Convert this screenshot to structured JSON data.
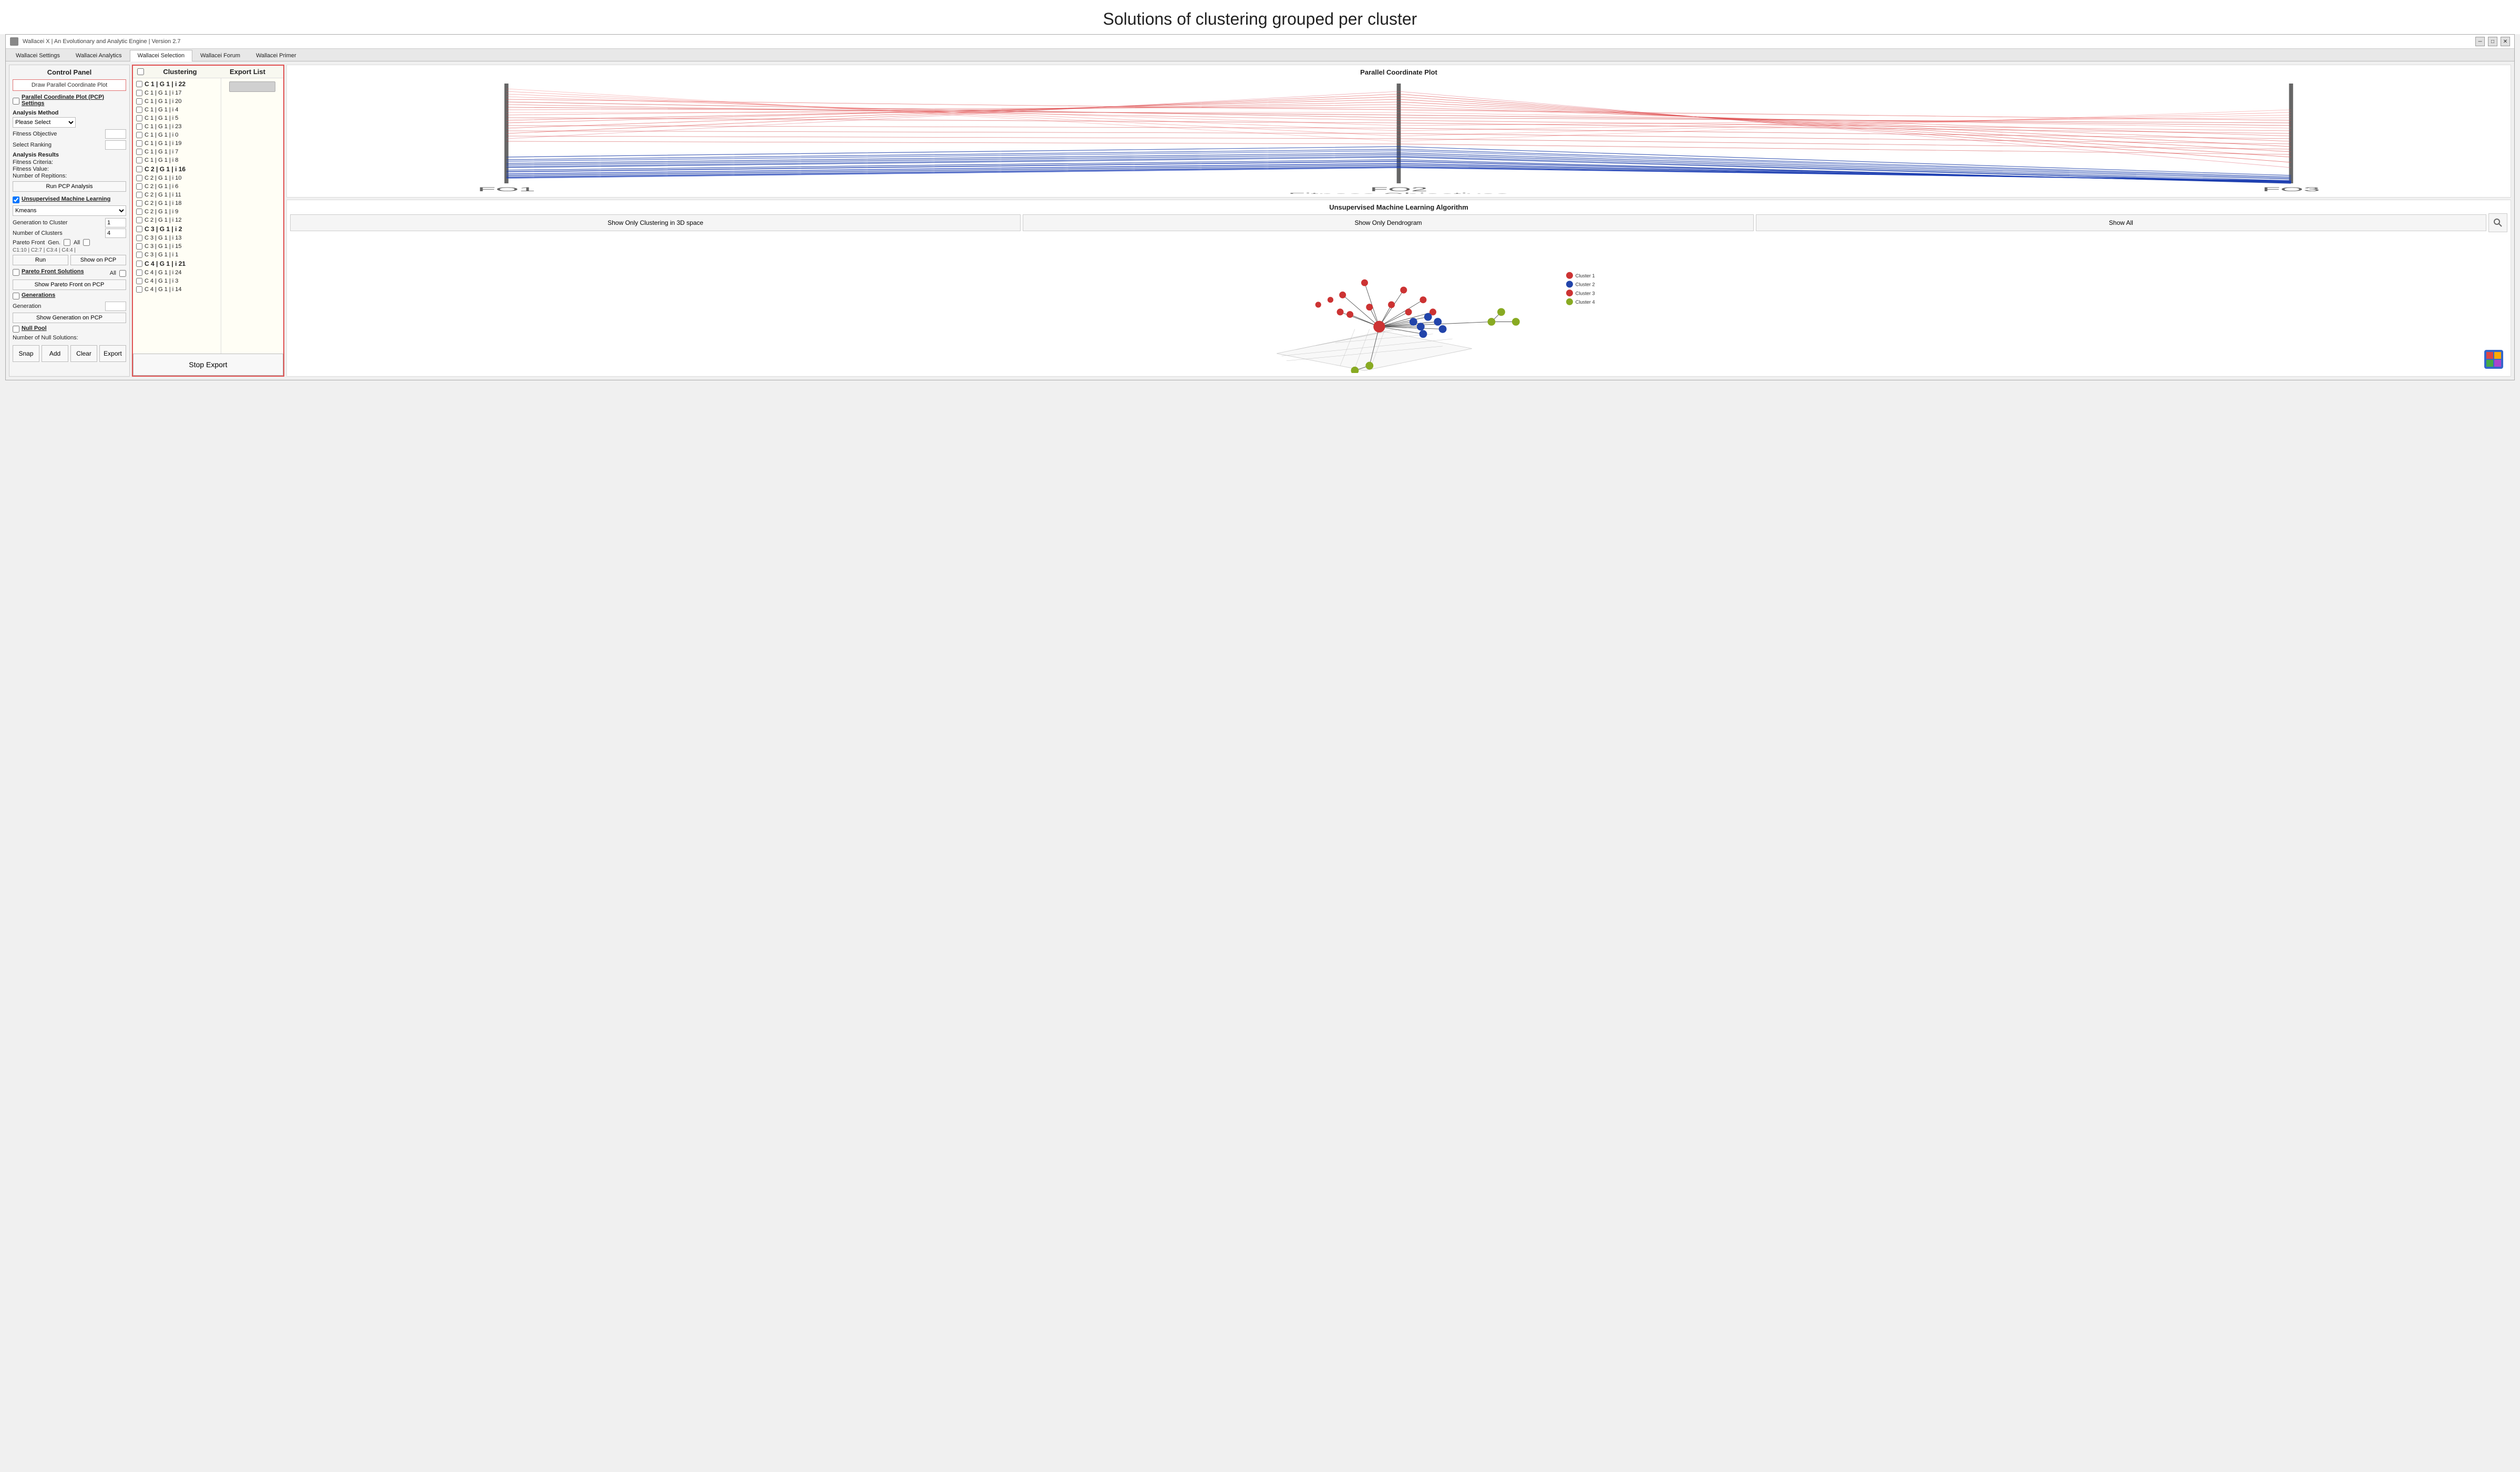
{
  "page": {
    "title": "Solutions of clustering grouped per cluster"
  },
  "window": {
    "app_title": "Wallacei X  |  An Evolutionary and Analytic Engine  |  Version 2.7"
  },
  "nav": {
    "tabs": [
      {
        "label": "Wallacei Settings",
        "active": false
      },
      {
        "label": "Wallacei Analytics",
        "active": false
      },
      {
        "label": "Wallacei Selection",
        "active": true
      },
      {
        "label": "Wallacei Forum",
        "active": false
      },
      {
        "label": "Wallacei Primer",
        "active": false
      }
    ]
  },
  "control_panel": {
    "title": "Control Panel",
    "draw_pcp_btn": "Draw Parallel Coordinate Plot",
    "pcp_settings_label": "Parallel Coordinate Plot (PCP) Settings",
    "analysis_method_label": "Analysis Method",
    "analysis_method_select": "Please Select",
    "fitness_objective_label": "Fitness Objective",
    "select_ranking_label": "Select Ranking",
    "analysis_results_label": "Analysis Results",
    "fitness_criteria_label": "Fitness Criteria:",
    "fitness_value_label": "Fitness Value:",
    "number_repetitions_label": "Number of Repitions:",
    "run_pcp_btn": "Run PCP Analysis",
    "unsupervised_ml_label": "Unsupervised Machine Learning",
    "kmeans_option": "Kmeans",
    "gen_to_cluster_label": "Generation to Cluster",
    "gen_to_cluster_value": "1",
    "num_clusters_label": "Number of Clusters",
    "num_clusters_value": "4",
    "pareto_front_label": "Pareto Front",
    "pareto_front_gen_label": "Gen.",
    "pareto_info": "C1:10 | C2:7 | C3:4 | C4:4 |",
    "run_btn": "Run",
    "show_on_pcp_btn": "Show on PCP",
    "pareto_front_solutions_label": "Pareto Front Solutions",
    "all_label": "All",
    "show_pareto_pcp_btn": "Show Pareto Front on PCP",
    "generations_label": "Generations",
    "generation_label": "Generation",
    "show_gen_pcp_btn": "Show Generation on PCP",
    "null_pool_label": "Null Pool",
    "num_null_solutions_label": "Number of Null Solutions:",
    "snap_btn": "Snap",
    "add_btn": "Add",
    "clear_btn": "Clear",
    "export_btn": "Export"
  },
  "clustering_panel": {
    "title": "Clustering",
    "items": [
      {
        "label": "C 1 | G 1 | i 22",
        "bold": true,
        "cluster": 1
      },
      {
        "label": "C 1 | G 1 | i 17",
        "bold": false,
        "cluster": 1
      },
      {
        "label": "C 1 | G 1 | i 20",
        "bold": false,
        "cluster": 1
      },
      {
        "label": "C 1 | G 1 | i 4",
        "bold": false,
        "cluster": 1
      },
      {
        "label": "C 1 | G 1 | i 5",
        "bold": false,
        "cluster": 1
      },
      {
        "label": "C 1 | G 1 | i 23",
        "bold": false,
        "cluster": 1
      },
      {
        "label": "C 1 | G 1 | i 0",
        "bold": false,
        "cluster": 1
      },
      {
        "label": "C 1 | G 1 | i 19",
        "bold": false,
        "cluster": 1
      },
      {
        "label": "C 1 | G 1 | i 7",
        "bold": false,
        "cluster": 1
      },
      {
        "label": "C 1 | G 1 | i 8",
        "bold": false,
        "cluster": 1
      },
      {
        "label": "C 2 | G 1 | i 16",
        "bold": true,
        "cluster": 2
      },
      {
        "label": "C 2 | G 1 | i 10",
        "bold": false,
        "cluster": 2
      },
      {
        "label": "C 2 | G 1 | i 6",
        "bold": false,
        "cluster": 2
      },
      {
        "label": "C 2 | G 1 | i 11",
        "bold": false,
        "cluster": 2
      },
      {
        "label": "C 2 | G 1 | i 18",
        "bold": false,
        "cluster": 2
      },
      {
        "label": "C 2 | G 1 | i 9",
        "bold": false,
        "cluster": 2
      },
      {
        "label": "C 2 | G 1 | i 12",
        "bold": false,
        "cluster": 2
      },
      {
        "label": "C 3 | G 1 | i 2",
        "bold": true,
        "cluster": 3
      },
      {
        "label": "C 3 | G 1 | i 13",
        "bold": false,
        "cluster": 3
      },
      {
        "label": "C 3 | G 1 | i 15",
        "bold": false,
        "cluster": 3
      },
      {
        "label": "C 3 | G 1 | i 1",
        "bold": false,
        "cluster": 3
      },
      {
        "label": "C 4 | G 1 | i 21",
        "bold": true,
        "cluster": 4
      },
      {
        "label": "C 4 | G 1 | i 24",
        "bold": false,
        "cluster": 4
      },
      {
        "label": "C 4 | G 1 | i 3",
        "bold": false,
        "cluster": 4
      },
      {
        "label": "C 4 | G 1 | i 14",
        "bold": false,
        "cluster": 4
      }
    ]
  },
  "export_list": {
    "title": "Export List",
    "stop_export_btn": "Stop Export"
  },
  "pcp_panel": {
    "title": "Parallel Coordinate Plot",
    "axis_labels": [
      "FO1",
      "FO2",
      "FO3"
    ],
    "fitness_objectives_label": "Fitness Objectives"
  },
  "ml_panel": {
    "title": "Unsupervised Machine Learning Algorithm",
    "show_clustering_btn": "Show Only Clustering in 3D space",
    "show_dendrogram_btn": "Show Only Dendrogram",
    "show_all_btn": "Show All",
    "cluster_labels": [
      "Cluster 1",
      "Cluster 2",
      "Cluster 3",
      "Cluster 4"
    ]
  },
  "colors": {
    "accent_red": "#e05050",
    "cluster1": "#cc3333",
    "cluster2": "#3333cc",
    "cluster3": "#cc3333",
    "cluster4": "#88aa22",
    "pcp_red": "#dd4444",
    "pcp_blue": "#2244aa"
  }
}
